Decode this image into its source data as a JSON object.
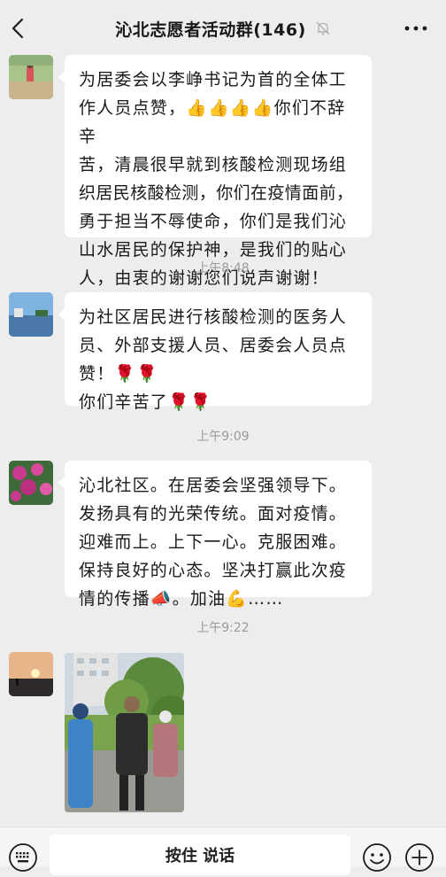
{
  "header": {
    "title": "沁北志愿者活动群(146)",
    "back_icon": "chevron-left-icon",
    "mute_icon": "bell-muted-icon",
    "more_icon": "ellipsis-icon"
  },
  "messages": [
    {
      "lines": [
        "为居委会以李峥书记为首的全体工",
        "作人员点赞，👍👍👍👍你们不辞辛",
        "苦，清晨很早就到核酸检测现场组",
        "织居民核酸检测，你们在疫情面前，",
        "勇于担当不辱使命，你们是我们沁",
        "山水居民的保护神，是我们的贴心",
        "人，由衷的谢谢您们说声谢谢！"
      ]
    },
    {
      "time": "上午8:48",
      "lines": [
        "为社区居民进行核酸检测的医务人",
        "员、外部支援人员、居委会人员点",
        "赞！🌹🌹",
        " 你们辛苦了🌹🌹"
      ]
    },
    {
      "time": "上午9:09",
      "lines": [
        "沁北社区。在居委会坚强领导下。",
        "发扬具有的光荣传统。面对疫情。",
        "迎难而上。上下一心。克服困难。",
        "保持良好的心态。坚决打赢此次疫",
        "情的传播📣。加油💪……"
      ]
    },
    {
      "time": "上午9:22"
    }
  ],
  "input_bar": {
    "voice_label": "按住 说话",
    "keyboard_icon": "keyboard-icon",
    "emoji_icon": "smiley-icon",
    "plus_icon": "plus-circle-icon"
  },
  "colors": {
    "background": "#ededed",
    "bubble": "#ffffff",
    "time_text": "#9b9b9b"
  }
}
